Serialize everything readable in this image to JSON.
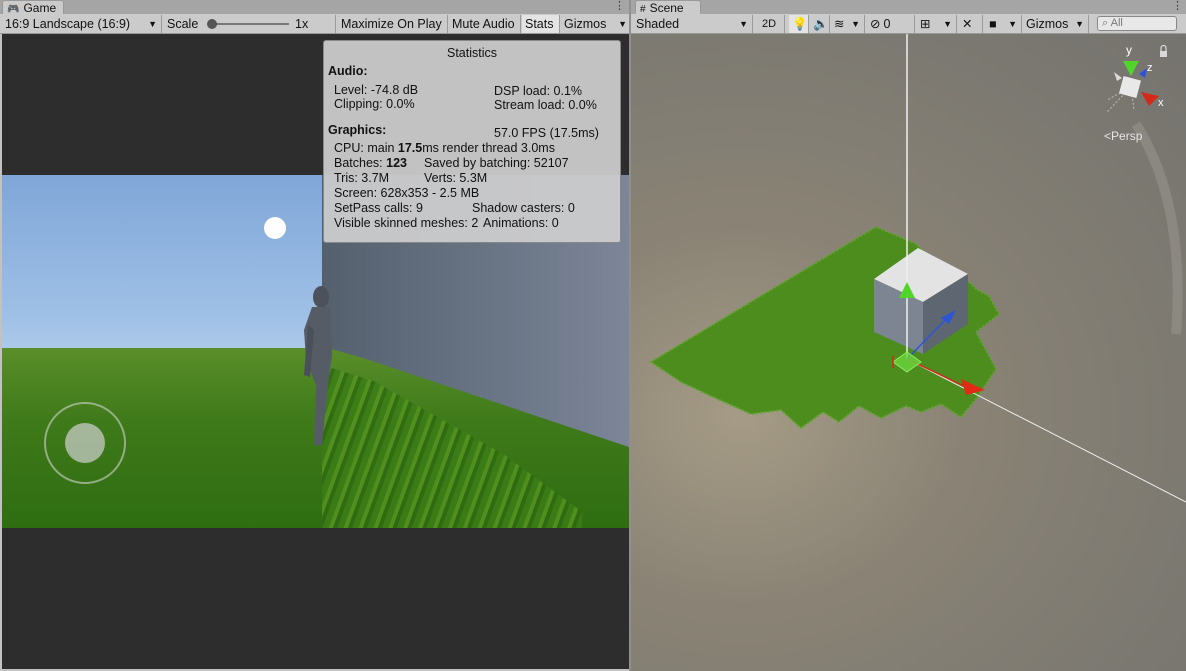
{
  "game": {
    "tab_label": "Game",
    "aspect_dropdown": "16:9 Landscape (16:9)",
    "scale_label": "Scale",
    "scale_value": "1x",
    "maximize_on_play": "Maximize On Play",
    "mute_audio": "Mute Audio",
    "stats": "Stats",
    "gizmos": "Gizmos"
  },
  "statistics": {
    "title": "Statistics",
    "audio_header": "Audio:",
    "level": "Level: -74.8 dB",
    "dsp_load": "DSP load: 0.1%",
    "clipping": "Clipping: 0.0%",
    "stream_load": "Stream load: 0.0%",
    "graphics_header": "Graphics:",
    "fps": "57.0 FPS (17.5ms)",
    "cpu_prefix": "CPU: main ",
    "cpu_main": "17.5",
    "cpu_suffix": "ms  render thread 3.0ms",
    "batches_prefix": "Batches: ",
    "batches_value": "123",
    "saved_by_batching": "Saved by batching: 52107",
    "tris": "Tris: 3.7M",
    "verts": "Verts: 5.3M",
    "screen": "Screen: 628x353 - 2.5 MB",
    "setpass": "SetPass calls: 9",
    "shadow_casters": "Shadow casters: 0",
    "skinned_meshes": "Visible skinned meshes: 2",
    "animations": "Animations: 0"
  },
  "scene": {
    "tab_label": "Scene",
    "shading_mode": "Shaded",
    "mode_2d": "2D",
    "hidden_count": "0",
    "gizmos": "Gizmos",
    "search_placeholder": "All",
    "persp_label": "Persp",
    "axis_x": "x",
    "axis_y": "y",
    "axis_z": "z"
  },
  "icons": [
    "gamepad-icon",
    "hash-icon",
    "kebab-menu-icon",
    "lightbulb-icon",
    "speaker-icon",
    "layers-icon",
    "eye-slash-icon",
    "grid-icon",
    "tools-icon",
    "camera-icon",
    "search-icon",
    "lock-icon",
    "chevron-down-icon"
  ],
  "colors": {
    "grass": "#3f7a1a",
    "axis_x": "#d32a1a",
    "axis_y": "#4fcf2a",
    "axis_z": "#2a55d8",
    "toolbar_bg": "#cbcbcb"
  }
}
